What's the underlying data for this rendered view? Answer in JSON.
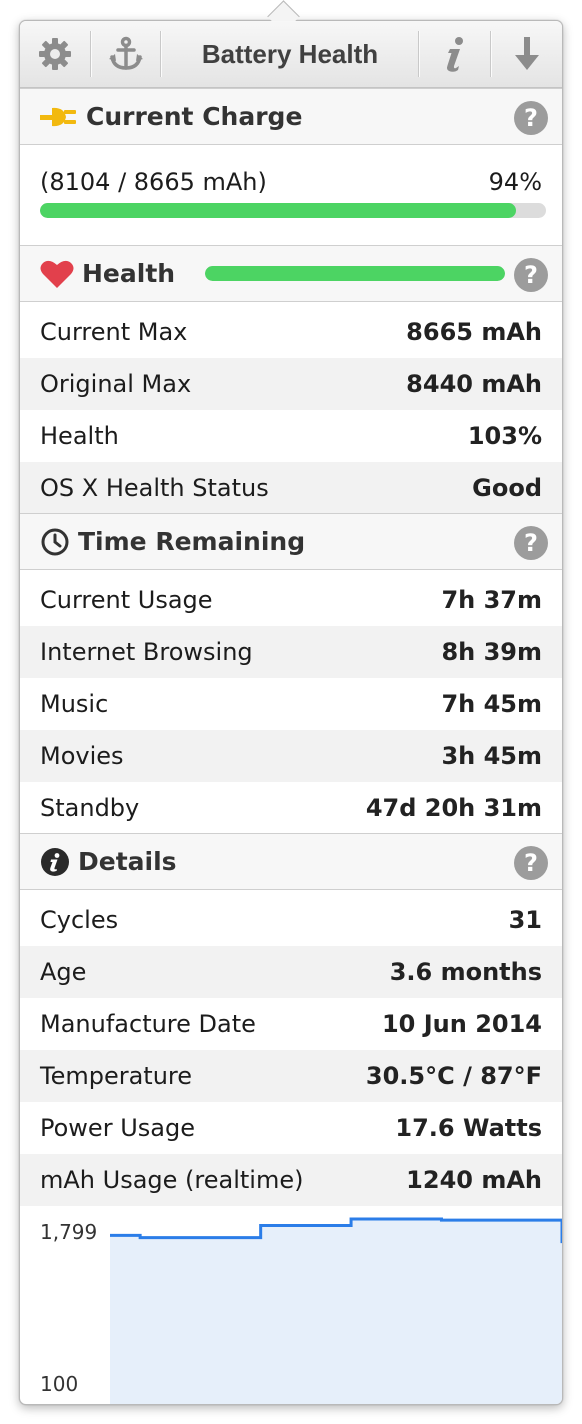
{
  "toolbar": {
    "title": "Battery Health",
    "settings_icon": "gear-icon",
    "anchor_icon": "anchor-icon",
    "info_icon": "info-icon",
    "download_icon": "down-arrow-icon"
  },
  "charge": {
    "title": "Current Charge",
    "icon": "plug-icon",
    "capacity_text": "(8104 / 8665 mAh)",
    "percent_text": "94%",
    "fill_percent": 94,
    "bar_color": "#4cd463"
  },
  "health": {
    "title": "Health",
    "icon": "heart-icon",
    "fill_percent": 100,
    "rows": [
      {
        "label": "Current Max",
        "value": "8665 mAh"
      },
      {
        "label": "Original Max",
        "value": "8440 mAh"
      },
      {
        "label": "Health",
        "value": "103%"
      },
      {
        "label": "OS X Health Status",
        "value": "Good"
      }
    ]
  },
  "time_remaining": {
    "title": "Time Remaining",
    "icon": "clock-icon",
    "rows": [
      {
        "label": "Current Usage",
        "value": "7h 37m"
      },
      {
        "label": "Internet Browsing",
        "value": "8h 39m"
      },
      {
        "label": "Music",
        "value": "7h 45m"
      },
      {
        "label": "Movies",
        "value": "3h 45m"
      },
      {
        "label": "Standby",
        "value": "47d 20h 31m"
      }
    ]
  },
  "details": {
    "title": "Details",
    "icon": "info-circle-icon",
    "rows": [
      {
        "label": "Cycles",
        "value": "31"
      },
      {
        "label": "Age",
        "value": "3.6 months"
      },
      {
        "label": "Manufacture Date",
        "value": "10 Jun 2014"
      },
      {
        "label": "Temperature",
        "value": "30.5°C / 87°F"
      },
      {
        "label": "Power Usage",
        "value": "17.6 Watts"
      },
      {
        "label": "mAh Usage (realtime)",
        "value": "1240 mAh"
      }
    ]
  },
  "help_label": "?",
  "chart_data": {
    "type": "area",
    "y_max_label": "1,799",
    "y_min_label": "100",
    "ylim": [
      100,
      1799
    ],
    "x": [
      0,
      1,
      2,
      3,
      4,
      5,
      6,
      7,
      8,
      9,
      10,
      11,
      12,
      13,
      14,
      15
    ],
    "values": [
      1640,
      1620,
      1620,
      1620,
      1620,
      1730,
      1730,
      1730,
      1790,
      1790,
      1790,
      1780,
      1780,
      1780,
      1780,
      1570
    ],
    "line_color": "#2b7de8",
    "fill_color": "#e6effa",
    "grid": false
  }
}
